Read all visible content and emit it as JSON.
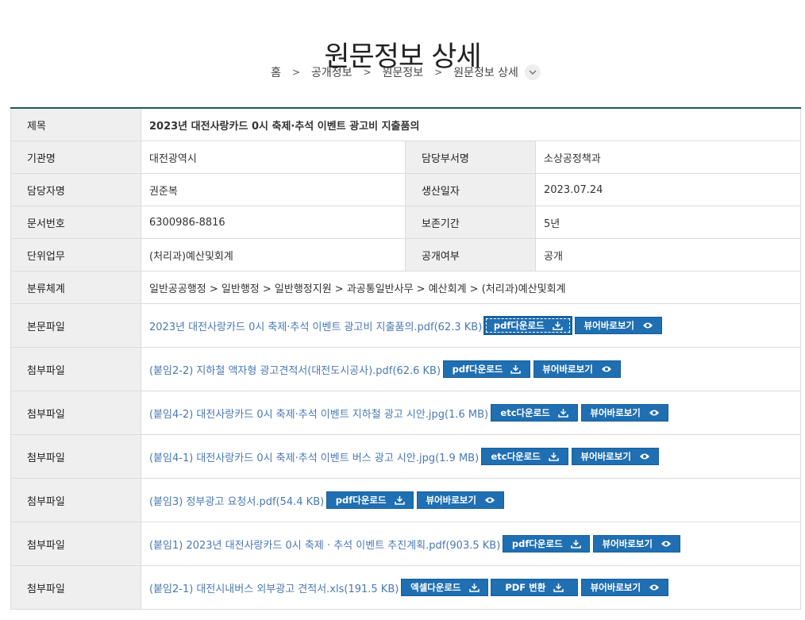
{
  "page": {
    "title": "원문정보 상세"
  },
  "breadcrumb": [
    "홈",
    "공개정보",
    "원문정보",
    "원문정보 상세"
  ],
  "labels": {
    "title": "제목",
    "agency": "기관명",
    "dept": "담당부서명",
    "manager": "담당자명",
    "date": "생산일자",
    "docno": "문서번호",
    "retention": "보존기간",
    "task": "단위업무",
    "disclosure": "공개여부",
    "classification": "분류체계",
    "main_file": "본문파일",
    "attach_file": "첨부파일"
  },
  "values": {
    "title": "2023년 대전사랑카드 0시 축제·추석 이벤트 광고비 지출품의",
    "agency": "대전광역시",
    "dept": "소상공정책과",
    "manager": "권준복",
    "date": "2023.07.24",
    "docno": "6300986-8816",
    "retention": "5년",
    "task": "(처리과)예산및회계",
    "disclosure": "공개",
    "classification": "일반공공행정 > 일반행정 > 일반행정지원 > 과공통일반사무 > 예산회계 > (처리과)예산및회계"
  },
  "files": [
    {
      "name": "2023년 대전사랑카드 0시 축제·추석 이벤트 광고비 지출품의.pdf(62.3 KB)",
      "download": "pdf다운로드",
      "view": "뷰어바로보기"
    },
    {
      "name": "(붙임2-2) 지하철 액자형 광고견적서(대전도시공사).pdf(62.6 KB)",
      "download": "pdf다운로드",
      "view": "뷰어바로보기"
    },
    {
      "name": "(붙임4-2) 대전사랑카드 0시 축제·추석 이벤트 지하철 광고 시안.jpg(1.6 MB)",
      "download": "etc다운로드",
      "view": "뷰어바로보기"
    },
    {
      "name": "(붙임4-1) 대전사랑카드 0시 축제·추석 이벤트 버스 광고 시안.jpg(1.9 MB)",
      "download": "etc다운로드",
      "view": "뷰어바로보기"
    },
    {
      "name": "(붙임3) 정부광고 요청서.pdf(54.4 KB)",
      "download": "pdf다운로드",
      "view": "뷰어바로보기"
    },
    {
      "name": "(붙임1) 2023년 대전사랑카드 0시 축제 · 추석 이벤트 추진계획.pdf(903.5 KB)",
      "download": "pdf다운로드",
      "view": "뷰어바로보기"
    },
    {
      "name": "(붙임2-1) 대전시내버스 외부광고 견적서.xls(191.5 KB)",
      "download": "엑셀다운로드",
      "convert": "PDF 변환",
      "view": "뷰어바로보기"
    }
  ],
  "colors": {
    "link": "#2a6cb3",
    "button": "#1f6fb2",
    "header_bg": "#efefef",
    "top_border": "#1d5c5a"
  },
  "icons": {
    "separator": "chevron-right-icon",
    "dropdown": "chevron-down-icon",
    "download": "download-icon",
    "view": "eye-icon"
  }
}
